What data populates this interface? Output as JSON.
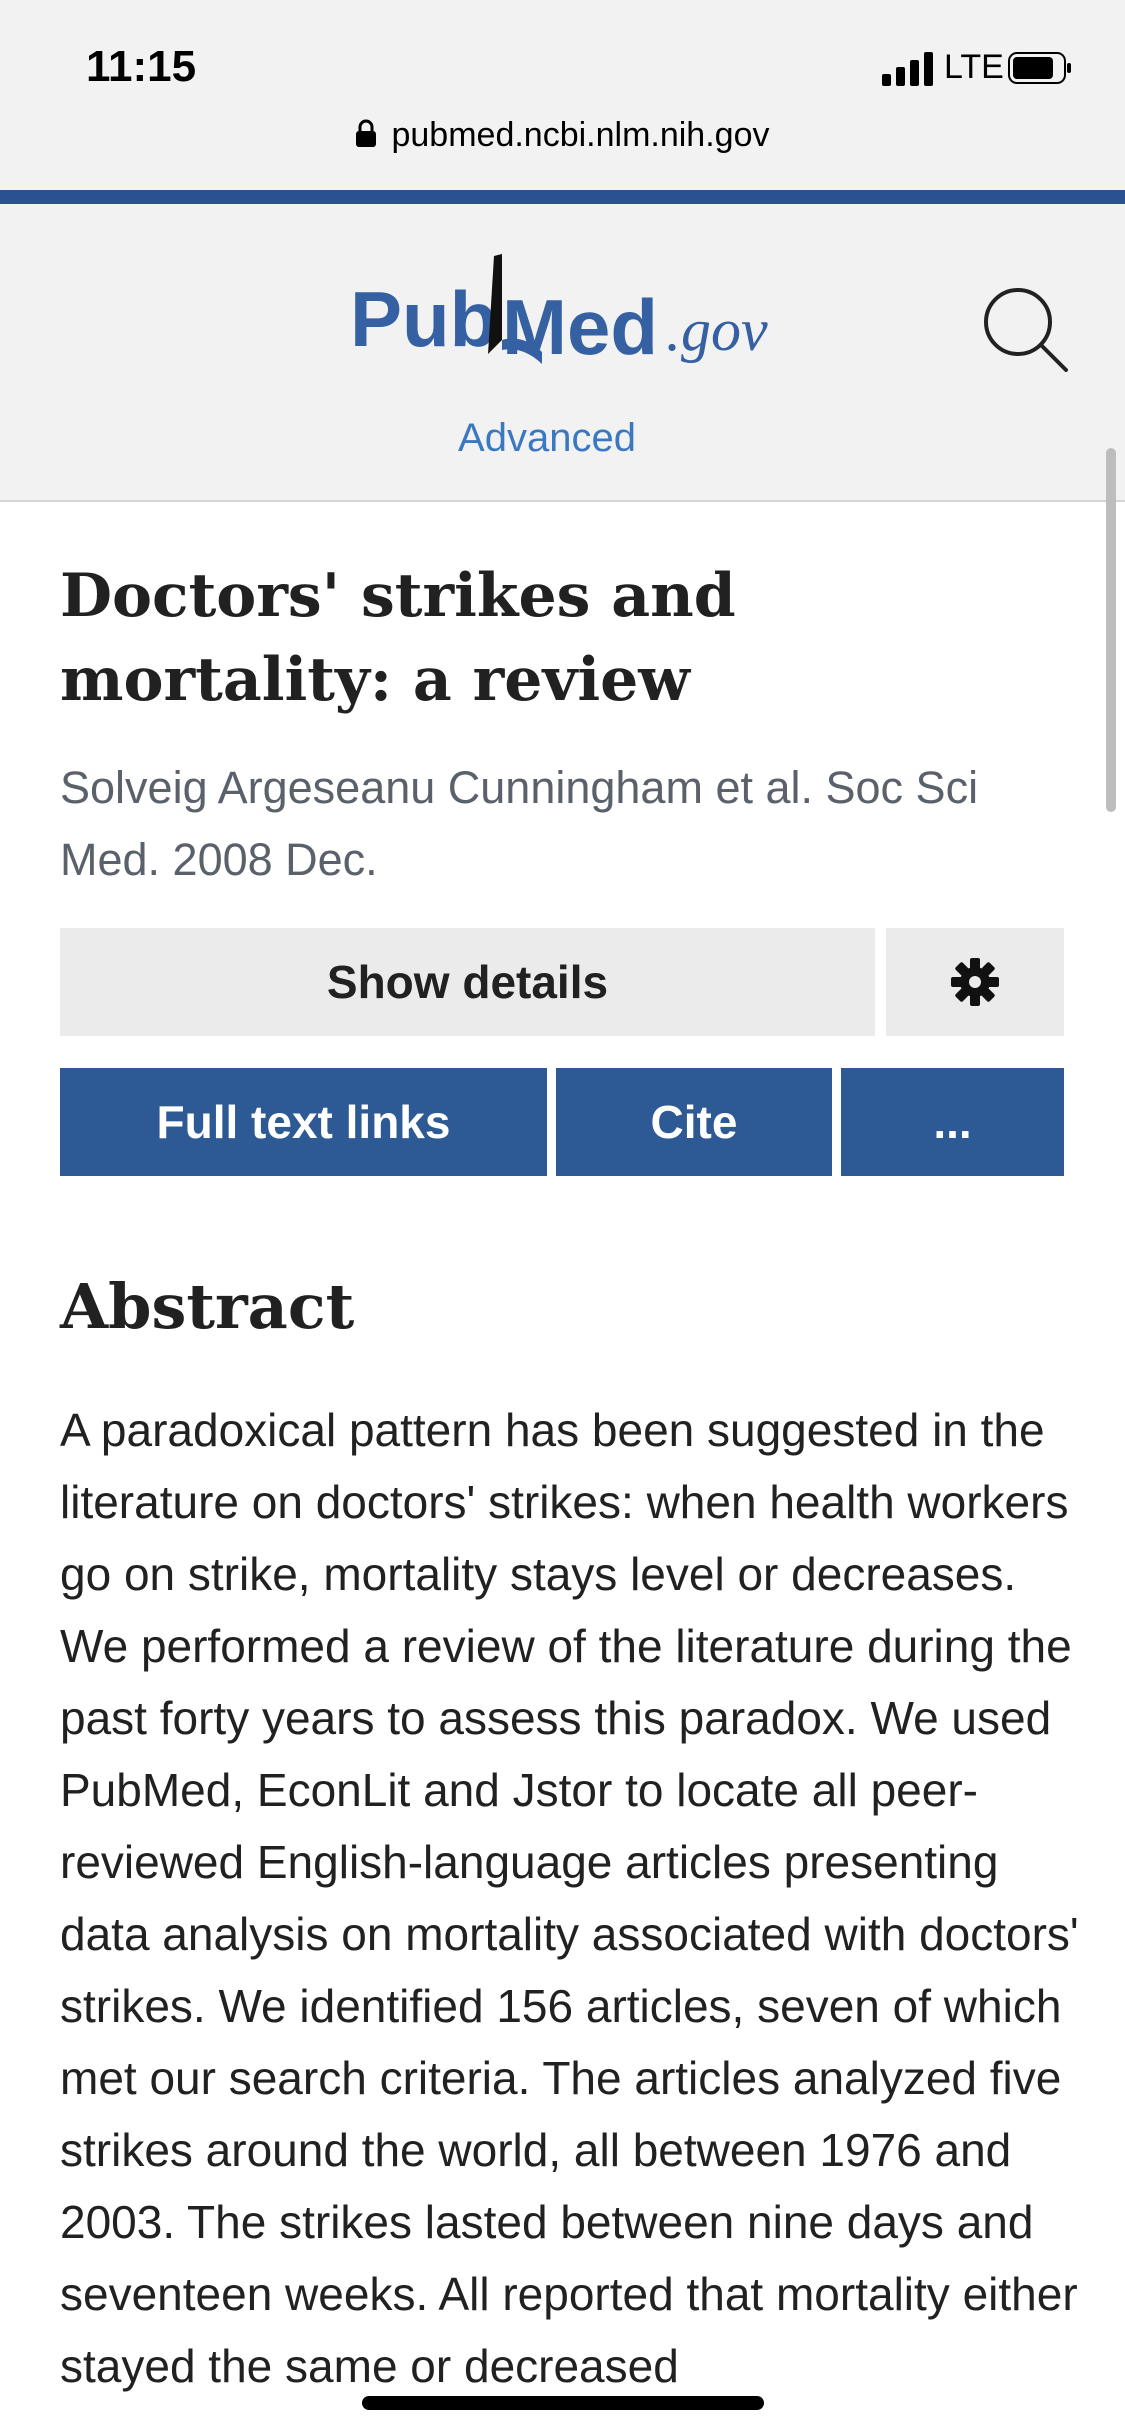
{
  "status": {
    "time": "11:15",
    "network": "LTE"
  },
  "browser": {
    "url": "pubmed.ncbi.nlm.nih.gov"
  },
  "header": {
    "logo_pub": "Pub",
    "logo_med": "Med",
    "logo_gov": ".gov",
    "advanced_label": "Advanced"
  },
  "article": {
    "title": "Doctors' strikes and mortality: a review",
    "authors": "Solveig Argeseanu Cunningham et al. Soc Sci Med. 2008 Dec."
  },
  "actions": {
    "show_details": "Show details",
    "full_text_links": "Full text links",
    "cite": "Cite",
    "more": "..."
  },
  "abstract": {
    "heading": "Abstract",
    "text": "A paradoxical pattern has been suggested in the literature on doctors' strikes: when health workers go on strike, mortality stays level or decreases. We performed a review of the literature during the past forty years to assess this paradox. We used PubMed, EconLit and Jstor to locate all peer-reviewed English-language articles presenting data analysis on mortality associated with doctors' strikes. We identified 156 articles, seven of which met our search criteria. The articles analyzed five strikes around the world, all between 1976 and 2003. The strikes lasted between nine days and seventeen weeks. All reported that mortality either stayed the same or decreased"
  },
  "colors": {
    "brand_blue": "#2d5a94",
    "link_blue": "#3a78c2",
    "accent_line": "#2a5290"
  }
}
